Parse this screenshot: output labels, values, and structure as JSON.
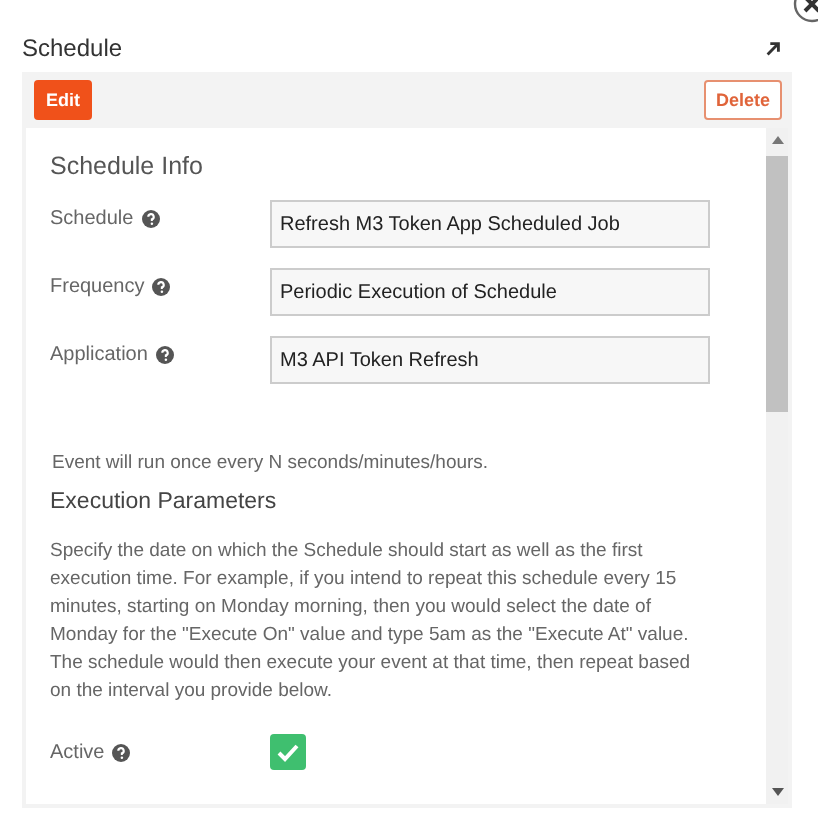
{
  "window": {
    "title": "Schedule"
  },
  "toolbar": {
    "edit": "Edit",
    "delete": "Delete"
  },
  "section_title": "Schedule Info",
  "fields": [
    {
      "label": "Schedule",
      "value": "Refresh M3 Token App Scheduled Job"
    },
    {
      "label": "Frequency",
      "value": "Periodic Execution of Schedule"
    },
    {
      "label": "Application",
      "value": "M3 API Token Refresh"
    }
  ],
  "frequency_note": "Event will run once every N seconds/minutes/hours.",
  "execution": {
    "title": "Execution Parameters",
    "description": "Specify the date on which the Schedule should start as well as the first execution time. For example, if you intend to repeat this schedule every 15 minutes, starting on Monday morning, then you would select the date of Monday for the \"Execute On\" value and type 5am as the \"Execute At\" value. The schedule would then execute your event at that time, then repeat based on the interval you provide below.",
    "active": {
      "label": "Active",
      "checked": true
    }
  }
}
